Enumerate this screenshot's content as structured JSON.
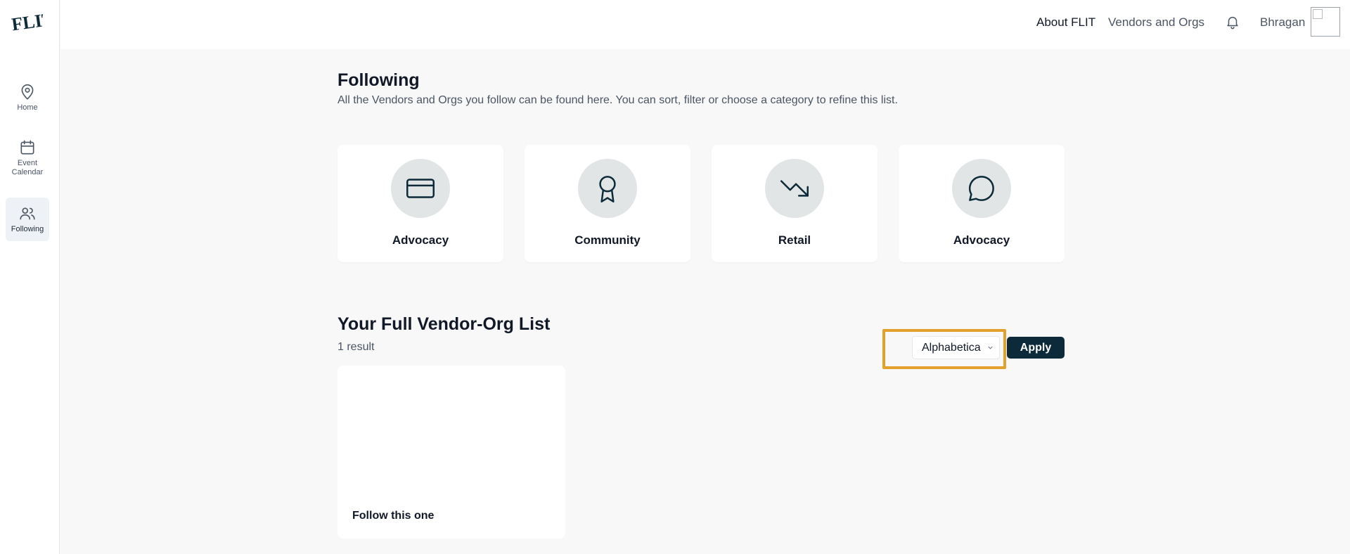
{
  "app": {
    "logo_text": "FLIT"
  },
  "sidebar": {
    "items": [
      {
        "label": "Home",
        "icon": "map-pin-icon"
      },
      {
        "label": "Event Calendar",
        "icon": "calendar-icon"
      },
      {
        "label": "Following",
        "icon": "users-icon",
        "active": true
      }
    ]
  },
  "header": {
    "links": [
      "About FLIT",
      "Vendors and Orgs"
    ],
    "username": "Bhragan",
    "icons": [
      "bell-icon",
      "avatar"
    ]
  },
  "page": {
    "title": "Following",
    "subtitle": "All the Vendors and Orgs you follow can be found here. You can sort, filter or choose a category to refine this list."
  },
  "categories": [
    {
      "label": "Advocacy",
      "icon": "credit-card-icon"
    },
    {
      "label": "Community",
      "icon": "award-ribbon-icon"
    },
    {
      "label": "Retail",
      "icon": "trending-down-icon"
    },
    {
      "label": "Advocacy",
      "icon": "chat-bubble-icon"
    }
  ],
  "list": {
    "title": "Your Full Vendor-Org List",
    "count": "1 result",
    "sort_value": "Alphabetica",
    "apply_label": "Apply",
    "items": [
      {
        "name": "Follow this one"
      }
    ]
  },
  "colors": {
    "highlight": "#e3a02a",
    "apply_bg": "#0c2a3a",
    "icon_circle": "#e1e5e5",
    "active_nav_bg": "#eef2f6"
  }
}
